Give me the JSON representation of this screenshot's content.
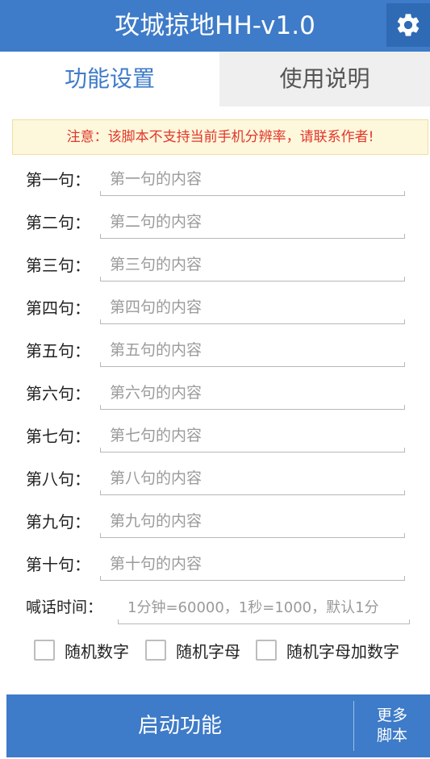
{
  "header": {
    "title": "攻城掠地HH-v1.0",
    "settings_icon": "gear-icon"
  },
  "tabs": [
    {
      "label": "功能设置",
      "active": true
    },
    {
      "label": "使用说明",
      "active": false
    }
  ],
  "notice": "注意：该脚本不支持当前手机分辨率，请联系作者!",
  "sentences": [
    {
      "label": "第一句：",
      "placeholder": "第一句的内容",
      "value": ""
    },
    {
      "label": "第二句：",
      "placeholder": "第二句的内容",
      "value": ""
    },
    {
      "label": "第三句：",
      "placeholder": "第三句的内容",
      "value": ""
    },
    {
      "label": "第四句：",
      "placeholder": "第四句的内容",
      "value": ""
    },
    {
      "label": "第五句：",
      "placeholder": "第五句的内容",
      "value": ""
    },
    {
      "label": "第六句：",
      "placeholder": "第六句的内容",
      "value": ""
    },
    {
      "label": "第七句：",
      "placeholder": "第七句的内容",
      "value": ""
    },
    {
      "label": "第八句：",
      "placeholder": "第八句的内容",
      "value": ""
    },
    {
      "label": "第九句：",
      "placeholder": "第九句的内容",
      "value": ""
    },
    {
      "label": "第十句：",
      "placeholder": "第十句的内容",
      "value": ""
    }
  ],
  "shout_time": {
    "label": "喊话时间：",
    "placeholder": "1分钟=60000，1秒=1000，默认1分",
    "value": ""
  },
  "options": [
    {
      "label": "随机数字",
      "checked": false
    },
    {
      "label": "随机字母",
      "checked": false
    },
    {
      "label": "随机字母加数字",
      "checked": false
    }
  ],
  "bottom": {
    "start_label": "启动功能",
    "more_line1": "更多",
    "more_line2": "脚本"
  },
  "colors": {
    "primary": "#3e7bc8",
    "settings_bg": "#2f6ab5",
    "notice_text": "#e2362a",
    "notice_bg": "#fdf7dc"
  }
}
